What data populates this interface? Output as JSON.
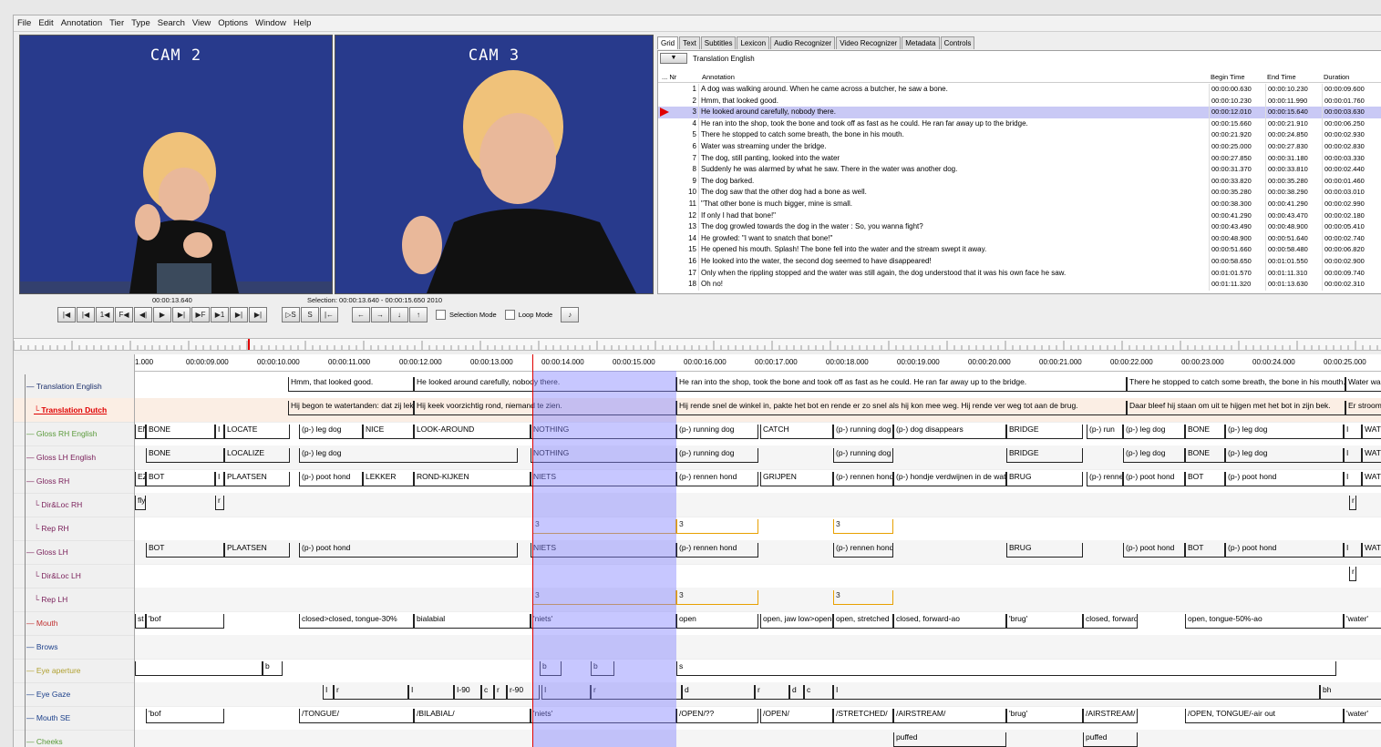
{
  "menu": [
    "File",
    "Edit",
    "Annotation",
    "Tier",
    "Type",
    "Search",
    "View",
    "Options",
    "Window",
    "Help"
  ],
  "video": {
    "cam_left": "CAM 2",
    "cam_right": "CAM 3"
  },
  "player": {
    "time": "00:00:13.640",
    "selection": "Selection: 00:00:13.640 - 00:00:15.650  2010",
    "selection_mode": "Selection Mode",
    "loop_mode": "Loop Mode",
    "buttons": [
      "|◀",
      "|◀",
      "1◀",
      "F◀",
      "◀|",
      "▶",
      "▶|",
      "▶F",
      "▶1",
      "▶|",
      "▶|"
    ],
    "sel_buttons": [
      "▷S",
      "S",
      "|←",
      "←",
      "→",
      "↓",
      "↑"
    ]
  },
  "tabs": [
    "Grid",
    "Text",
    "Subtitles",
    "Lexicon",
    "Audio Recognizer",
    "Video Recognizer",
    "Metadata",
    "Controls"
  ],
  "grid": {
    "tier": "Translation English",
    "headers": {
      "nr": "... Nr",
      "annotation": "Annotation",
      "begin": "Begin Time",
      "end": "End Time",
      "duration": "Duration"
    },
    "rows": [
      {
        "nr": "1",
        "text": "A dog was walking around. When he came across a butcher, he saw a bone.",
        "begin": "00:00:00.630",
        "end": "00:00:10.230",
        "dur": "00:00:09.600"
      },
      {
        "nr": "2",
        "text": "Hmm, that looked good.",
        "begin": "00:00:10.230",
        "end": "00:00:11.990",
        "dur": "00:00:01.760"
      },
      {
        "nr": "3",
        "text": "He looked around carefully, nobody there.",
        "begin": "00:00:12.010",
        "end": "00:00:15.640",
        "dur": "00:00:03.630"
      },
      {
        "nr": "4",
        "text": "He ran into the shop, took the bone and took off as fast as he could. He ran far away up to the bridge.",
        "begin": "00:00:15.660",
        "end": "00:00:21.910",
        "dur": "00:00:06.250"
      },
      {
        "nr": "5",
        "text": "There he stopped to catch some breath, the bone in his mouth.",
        "begin": "00:00:21.920",
        "end": "00:00:24.850",
        "dur": "00:00:02.930"
      },
      {
        "nr": "6",
        "text": "Water was streaming under the bridge.",
        "begin": "00:00:25.000",
        "end": "00:00:27.830",
        "dur": "00:00:02.830"
      },
      {
        "nr": "7",
        "text": "The dog, still panting, looked into the water",
        "begin": "00:00:27.850",
        "end": "00:00:31.180",
        "dur": "00:00:03.330"
      },
      {
        "nr": "8",
        "text": "Suddenly he was alarmed by what he saw. There in the water was another dog.",
        "begin": "00:00:31.370",
        "end": "00:00:33.810",
        "dur": "00:00:02.440"
      },
      {
        "nr": "9",
        "text": "The dog barked.",
        "begin": "00:00:33.820",
        "end": "00:00:35.280",
        "dur": "00:00:01.460"
      },
      {
        "nr": "10",
        "text": "The dog saw that the other dog had a bone as well.",
        "begin": "00:00:35.280",
        "end": "00:00:38.290",
        "dur": "00:00:03.010"
      },
      {
        "nr": "11",
        "text": "\"That other bone is much bigger, mine is small.",
        "begin": "00:00:38.300",
        "end": "00:00:41.290",
        "dur": "00:00:02.990"
      },
      {
        "nr": "12",
        "text": "If only I had that bone!\"",
        "begin": "00:00:41.290",
        "end": "00:00:43.470",
        "dur": "00:00:02.180"
      },
      {
        "nr": "13",
        "text": "The dog growled towards the dog in the water : So, you wanna fight?",
        "begin": "00:00:43.490",
        "end": "00:00:48.900",
        "dur": "00:00:05.410"
      },
      {
        "nr": "14",
        "text": "He growled: \"I want to snatch that bone!\"",
        "begin": "00:00:48.900",
        "end": "00:00:51.640",
        "dur": "00:00:02.740"
      },
      {
        "nr": "15",
        "text": "He opened his mouth. Splash! The bone fell into the water and the stream swept it away.",
        "begin": "00:00:51.660",
        "end": "00:00:58.480",
        "dur": "00:00:06.820"
      },
      {
        "nr": "16",
        "text": "He looked into the water, the second dog seemed to have disappeared!",
        "begin": "00:00:58.650",
        "end": "00:01:01.550",
        "dur": "00:00:02.900"
      },
      {
        "nr": "17",
        "text": "Only when the rippling stopped and the water was still again, the dog understood that it was his own face he saw.",
        "begin": "00:01:01.570",
        "end": "00:01:11.310",
        "dur": "00:00:09.740"
      },
      {
        "nr": "18",
        "text": "Oh no!",
        "begin": "00:01:11.320",
        "end": "00:01:13.630",
        "dur": "00:00:02.310"
      }
    ]
  },
  "ruler_ticks": [
    "1.000",
    "00:00:09.000",
    "00:00:10.000",
    "00:00:11.000",
    "00:00:12.000",
    "00:00:13.000",
    "00:00:14.000",
    "00:00:15.000",
    "00:00:16.000",
    "00:00:17.000",
    "00:00:18.000",
    "00:00:19.000",
    "00:00:20.000",
    "00:00:21.000",
    "00:00:22.000",
    "00:00:23.000",
    "00:00:24.000",
    "00:00:25.000"
  ],
  "tiers": [
    {
      "name": "Translation English",
      "color": "#1b2f6b",
      "indent": 0,
      "parent": true
    },
    {
      "name": "Translation Dutch",
      "color": "#e00000",
      "indent": 1,
      "active": true
    },
    {
      "name": "Gloss RH English",
      "color": "#5a9a3a",
      "indent": 0
    },
    {
      "name": "Gloss LH English",
      "color": "#7a1f5a",
      "indent": 0
    },
    {
      "name": "Gloss RH",
      "color": "#7a1f5a",
      "indent": 0,
      "parent": true
    },
    {
      "name": "Dir&Loc RH",
      "color": "#7a1f5a",
      "indent": 1
    },
    {
      "name": "Rep RH",
      "color": "#7a1f5a",
      "indent": 1
    },
    {
      "name": "Gloss LH",
      "color": "#7a1f5a",
      "indent": 0,
      "parent": true
    },
    {
      "name": "Dir&Loc LH",
      "color": "#7a1f5a",
      "indent": 1
    },
    {
      "name": "Rep LH",
      "color": "#7a1f5a",
      "indent": 1
    },
    {
      "name": "Mouth",
      "color": "#c03030",
      "indent": 0
    },
    {
      "name": "Brows",
      "color": "#1b3f8a",
      "indent": 0
    },
    {
      "name": "Eye aperture",
      "color": "#b0a030",
      "indent": 0
    },
    {
      "name": "Eye Gaze",
      "color": "#1b3f8a",
      "indent": 0
    },
    {
      "name": "Mouth SE",
      "color": "#1b3f8a",
      "indent": 0
    },
    {
      "name": "Cheeks",
      "color": "#5a9a3a",
      "indent": 0
    }
  ],
  "annotations": [
    [
      [
        168,
        306,
        "Hmm, that looked good."
      ],
      [
        306,
        594,
        "He looked around carefully, nobody there."
      ],
      [
        594,
        1088,
        "He ran into the shop, took the bone and took off as fast as he could. He ran far away up to the bridge."
      ],
      [
        1088,
        1328,
        "There he stopped to catch some breath, the bone in his mouth."
      ],
      [
        1328,
        1368,
        "Water was streaming under the bridge."
      ]
    ],
    [
      [
        168,
        306,
        "Hij begon te watertanden: dat zij lekker uit."
      ],
      [
        306,
        594,
        "Hij keek voorzichtig rond, niemand te zien."
      ],
      [
        594,
        1088,
        "Hij rende snel de winkel in, pakte het bot en rende er zo snel als hij kon mee weg. Hij rende ver weg tot aan de brug."
      ],
      [
        1088,
        1328,
        "Daar bleef hij staan om uit te hijgen met het bot in zijn bek."
      ],
      [
        1328,
        1368,
        "Er stroomde water onder de brug."
      ]
    ],
    [
      [
        0,
        12,
        "EN"
      ],
      [
        12,
        88,
        "BONE"
      ],
      [
        88,
        98,
        "I"
      ],
      [
        98,
        170,
        "LOCATE"
      ],
      [
        180,
        250,
        "(p-) leg dog"
      ],
      [
        250,
        306,
        "NICE"
      ],
      [
        306,
        434,
        "LOOK-AROUND"
      ],
      [
        434,
        594,
        "NOTHING"
      ],
      [
        594,
        684,
        "(p-) running dog"
      ],
      [
        686,
        766,
        "CATCH"
      ],
      [
        766,
        832,
        "(p-) running dog"
      ],
      [
        832,
        956,
        "(p-) dog disappears"
      ],
      [
        956,
        1040,
        "BRIDGE"
      ],
      [
        1044,
        1084,
        "(p-) run"
      ],
      [
        1084,
        1152,
        "(p-) leg dog"
      ],
      [
        1152,
        1196,
        "BONE"
      ],
      [
        1196,
        1326,
        "(p-) leg dog"
      ],
      [
        1326,
        1346,
        "I"
      ],
      [
        1346,
        1368,
        "WATER"
      ]
    ],
    [
      [
        12,
        98,
        "BONE"
      ],
      [
        98,
        170,
        "LOCALIZE"
      ],
      [
        180,
        420,
        "(p-) leg dog"
      ],
      [
        434,
        594,
        "NOTHING"
      ],
      [
        594,
        684,
        "(p-) running dog"
      ],
      [
        766,
        832,
        "(p-) running dog"
      ],
      [
        956,
        1040,
        "BRIDGE"
      ],
      [
        1084,
        1152,
        "(p-) leg dog"
      ],
      [
        1152,
        1196,
        "BONE"
      ],
      [
        1196,
        1326,
        "(p-) leg dog"
      ],
      [
        1326,
        1346,
        "I"
      ],
      [
        1346,
        1368,
        "WATER"
      ]
    ],
    [
      [
        0,
        12,
        "EZ"
      ],
      [
        12,
        88,
        "BOT"
      ],
      [
        88,
        98,
        "I"
      ],
      [
        98,
        170,
        "PLAATSEN"
      ],
      [
        180,
        250,
        "(p-) poot hond"
      ],
      [
        250,
        306,
        "LEKKER"
      ],
      [
        306,
        434,
        "ROND-KIJKEN"
      ],
      [
        434,
        594,
        "NIETS"
      ],
      [
        594,
        684,
        "(p-) rennen hond"
      ],
      [
        686,
        766,
        "GRIJPEN"
      ],
      [
        766,
        832,
        "(p-) rennen hond"
      ],
      [
        832,
        956,
        "(p-) hondje verdwijnen in de water"
      ],
      [
        956,
        1040,
        "BRUG"
      ],
      [
        1044,
        1084,
        "(p-) rennen"
      ],
      [
        1084,
        1152,
        "(p-) poot hond"
      ],
      [
        1152,
        1196,
        "BOT"
      ],
      [
        1196,
        1326,
        "(p-) poot hond"
      ],
      [
        1326,
        1346,
        "I"
      ],
      [
        1346,
        1368,
        "WATER"
      ]
    ],
    [
      [
        0,
        12,
        "fly"
      ],
      [
        88,
        98,
        "r"
      ],
      [
        1332,
        1340,
        "r"
      ]
    ],
    [
      [
        436,
        594,
        "3"
      ],
      [
        594,
        684,
        "3"
      ],
      [
        766,
        832,
        "3"
      ]
    ],
    [
      [
        12,
        98,
        "BOT"
      ],
      [
        98,
        170,
        "PLAATSEN"
      ],
      [
        180,
        420,
        "(p-) poot hond"
      ],
      [
        434,
        594,
        "NIETS"
      ],
      [
        594,
        684,
        "(p-) rennen hond"
      ],
      [
        766,
        832,
        "(p-) rennen hond"
      ],
      [
        956,
        1040,
        "BRUG"
      ],
      [
        1084,
        1152,
        "(p-) poot hond"
      ],
      [
        1152,
        1196,
        "BOT"
      ],
      [
        1196,
        1326,
        "(p-) poot hond"
      ],
      [
        1326,
        1346,
        "I"
      ],
      [
        1346,
        1368,
        "WATER"
      ]
    ],
    [
      [
        1332,
        1340,
        "r"
      ]
    ],
    [
      [
        436,
        594,
        "3"
      ],
      [
        594,
        684,
        "3"
      ],
      [
        766,
        832,
        "3"
      ]
    ],
    [
      [
        0,
        12,
        "st"
      ],
      [
        12,
        98,
        "'bof"
      ],
      [
        180,
        306,
        "closed>closed, tongue-30%"
      ],
      [
        306,
        434,
        "bialabial"
      ],
      [
        434,
        594,
        "'niets'"
      ],
      [
        594,
        684,
        "open"
      ],
      [
        686,
        766,
        "open, jaw low>open"
      ],
      [
        766,
        832,
        "open, stretched"
      ],
      [
        832,
        956,
        "closed, forward-ao"
      ],
      [
        956,
        1040,
        "'brug'"
      ],
      [
        1040,
        1100,
        "closed, forward"
      ],
      [
        1152,
        1326,
        "open, tongue-50%-ao"
      ],
      [
        1326,
        1368,
        "'water'"
      ]
    ],
    [],
    [
      [
        0,
        140,
        ""
      ],
      [
        140,
        162,
        "b"
      ],
      [
        444,
        468,
        "b"
      ],
      [
        500,
        526,
        "b"
      ],
      [
        594,
        1318,
        "s"
      ]
    ],
    [
      [
        206,
        218,
        "I"
      ],
      [
        218,
        300,
        "r"
      ],
      [
        300,
        350,
        "I"
      ],
      [
        350,
        380,
        "I-90"
      ],
      [
        380,
        394,
        "c"
      ],
      [
        394,
        408,
        "r"
      ],
      [
        408,
        444,
        "r-90"
      ],
      [
        446,
        500,
        "I"
      ],
      [
        500,
        600,
        "r"
      ],
      [
        600,
        680,
        "d"
      ],
      [
        680,
        718,
        "r"
      ],
      [
        718,
        734,
        "d"
      ],
      [
        734,
        766,
        "c"
      ],
      [
        766,
        1300,
        "I"
      ],
      [
        1300,
        1368,
        "bh"
      ]
    ],
    [
      [
        12,
        98,
        "'bof"
      ],
      [
        180,
        306,
        "/TONGUE/"
      ],
      [
        306,
        434,
        "/BILABIAL/"
      ],
      [
        434,
        594,
        "'niets'"
      ],
      [
        594,
        684,
        "/OPEN/??"
      ],
      [
        686,
        766,
        "/OPEN/"
      ],
      [
        766,
        832,
        "/STRETCHED/"
      ],
      [
        832,
        956,
        "/AIRSTREAM/"
      ],
      [
        956,
        1040,
        "'brug'"
      ],
      [
        1040,
        1100,
        "/AIRSTREAM/"
      ],
      [
        1152,
        1326,
        "/OPEN, TONGUE/-air out"
      ],
      [
        1326,
        1368,
        "'water'"
      ]
    ],
    [
      [
        832,
        956,
        "puffed"
      ],
      [
        1040,
        1100,
        "puffed"
      ]
    ]
  ]
}
